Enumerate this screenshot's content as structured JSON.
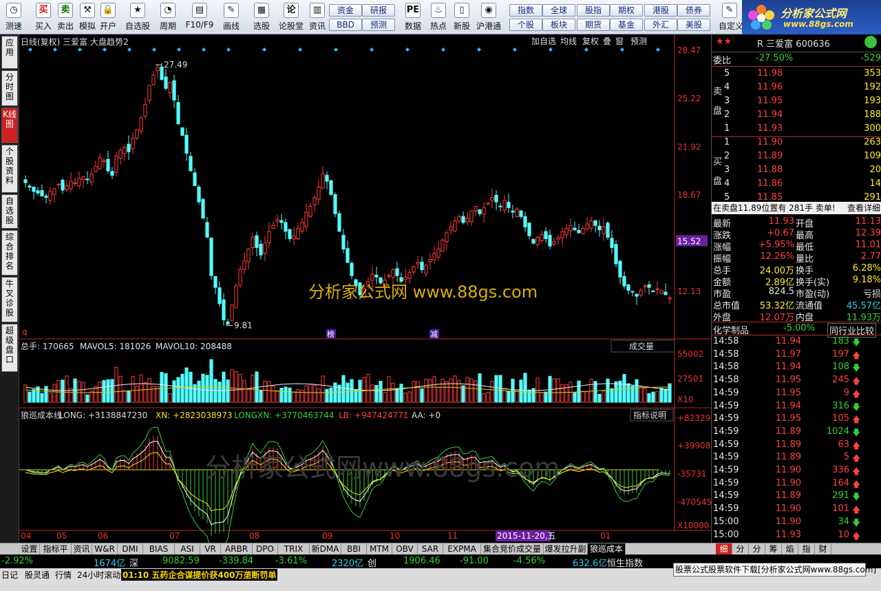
{
  "toolbar": {
    "buttons": [
      {
        "icon": "clock-icon",
        "glyph": "◷",
        "label": "测速"
      },
      {
        "icon": "buy-icon",
        "glyph": "买",
        "label": "买入"
      },
      {
        "icon": "sell-icon",
        "glyph": "卖",
        "label": "卖出"
      },
      {
        "icon": "hammer-icon",
        "glyph": "⚒",
        "label": "模拟"
      },
      {
        "icon": "lock-icon",
        "glyph": "🔒",
        "label": "开户"
      },
      {
        "icon": "star-icon",
        "glyph": "★",
        "label": "自选股"
      },
      {
        "icon": "period-icon",
        "glyph": "◔",
        "label": "周期"
      },
      {
        "icon": "f10-icon",
        "glyph": "▤",
        "label": "F10/F9"
      },
      {
        "icon": "pen-icon",
        "glyph": "✎",
        "label": "画线"
      },
      {
        "icon": "select-icon",
        "glyph": "▦",
        "label": "选股"
      },
      {
        "icon": "forum-icon",
        "glyph": "论",
        "label": "论股堂"
      },
      {
        "icon": "info-icon",
        "glyph": "▥",
        "label": "资讯"
      },
      {
        "icon": "pe-icon",
        "glyph": "PE",
        "label": "数据"
      },
      {
        "icon": "hot-icon",
        "glyph": "♨",
        "label": "热点"
      },
      {
        "icon": "new-icon",
        "glyph": "▯",
        "label": "新股"
      },
      {
        "icon": "hk-connect-icon",
        "glyph": "◉",
        "label": "沪港通"
      },
      {
        "icon": "custom-icon",
        "glyph": "✎",
        "label": "自定义"
      }
    ],
    "quick_buttons": [
      {
        "label": "资金",
        "key": "fund"
      },
      {
        "label": "研报",
        "key": "research"
      },
      {
        "label": "BBD",
        "key": "bbd"
      },
      {
        "label": "预测",
        "key": "forecast"
      },
      {
        "label": "指数",
        "key": "index"
      },
      {
        "label": "全球",
        "key": "global"
      },
      {
        "label": "股指",
        "key": "stockindex"
      },
      {
        "label": "期权",
        "key": "options"
      },
      {
        "label": "港股",
        "key": "hkstock"
      },
      {
        "label": "债券",
        "key": "bond"
      },
      {
        "label": "个股",
        "key": "stock"
      },
      {
        "label": "板块",
        "key": "sector"
      },
      {
        "label": "期货",
        "key": "futures"
      },
      {
        "label": "基金",
        "key": "funds"
      },
      {
        "label": "外汇",
        "key": "forex"
      },
      {
        "label": "美股",
        "key": "usstock"
      }
    ],
    "logo_text": "分析家公式网",
    "logo_url": "www.88gs.com"
  },
  "sidebar": {
    "items": [
      {
        "label": "应用",
        "key": "apps"
      },
      {
        "label": "分时图",
        "key": "intraday"
      },
      {
        "label": "K线图",
        "key": "kline",
        "active": true
      },
      {
        "label": "个股资料",
        "key": "profile"
      },
      {
        "label": "自选股",
        "key": "watchlist"
      },
      {
        "label": "综合排名",
        "key": "ranking"
      },
      {
        "label": "牛叉诊股",
        "key": "diagnose"
      },
      {
        "label": "超级盘口",
        "key": "superbook"
      }
    ]
  },
  "chart_header": {
    "title": "日线(复权)  三爱富 大盘趋势2",
    "buttons": [
      "加自选",
      "均线",
      "复权",
      "叠",
      "窗",
      "预测"
    ]
  },
  "chart_data": [
    {
      "type": "candlestick",
      "title": "日线(复权) 三爱富 大盘趋势2",
      "y_ticks": [
        "28.47",
        "25.22",
        "21.92",
        "18.67",
        "15.52",
        "12.13"
      ],
      "ylim": [
        9.0,
        28.9
      ],
      "current_price_label": "15.52",
      "annotations": {
        "high": "27.49",
        "low": "9.81"
      },
      "markers": [
        "榜",
        "减"
      ],
      "x_ticks": [
        "04",
        "05",
        "06",
        "07",
        "08",
        "09",
        "10",
        "11",
        "2015-11-20,五",
        "01"
      ],
      "close_series": [
        19.5,
        19.2,
        18.9,
        18.8,
        18.6,
        18.5,
        18.9,
        19.1,
        19.4,
        19.0,
        19.3,
        19.6,
        19.5,
        19.8,
        19.9,
        19.7,
        20.1,
        20.6,
        21.2,
        21.0,
        20.3,
        20.0,
        21.3,
        21.7,
        21.9,
        21.6,
        22.5,
        23.1,
        23.9,
        24.8,
        26.1,
        26.8,
        27.3,
        26.5,
        25.9,
        26.3,
        25.1,
        23.5,
        22.7,
        21.5,
        20.3,
        19.3,
        18.2,
        17.1,
        15.8,
        13.2,
        12.4,
        11.3,
        10.2,
        9.9,
        11.2,
        12.5,
        13.6,
        14.2,
        15.0,
        15.8,
        15.1,
        14.6,
        15.4,
        16.2,
        16.6,
        17.0,
        16.8,
        16.2,
        15.7,
        15.9,
        16.4,
        16.8,
        17.5,
        17.9,
        18.5,
        19.2,
        20.1,
        19.6,
        18.7,
        17.4,
        16.2,
        15.0,
        14.1,
        13.2,
        12.5,
        11.9,
        12.3,
        12.8,
        13.3,
        13.1,
        12.7,
        12.9,
        13.2,
        13.6,
        13.2,
        12.8,
        13.1,
        13.4,
        13.8,
        14.1,
        13.6,
        13.9,
        14.3,
        14.7,
        15.0,
        15.6,
        16.1,
        16.5,
        16.9,
        17.2,
        16.8,
        17.1,
        17.6,
        17.9,
        17.4,
        17.8,
        18.1,
        18.5,
        18.2,
        17.9,
        18.3,
        17.8,
        17.5,
        17.7,
        17.2,
        16.5,
        15.9,
        15.4,
        15.8,
        16.0,
        15.7,
        15.2,
        15.5,
        15.8,
        16.2,
        16.4,
        16.6,
        16.3,
        16.1,
        16.4,
        16.7,
        16.9,
        16.6,
        16.3,
        16.5,
        15.8,
        15.1,
        14.0,
        13.1,
        12.5,
        12.2,
        12.1,
        11.8,
        12.2,
        12.5,
        12.4,
        12.1,
        12.3,
        12.2,
        11.9,
        11.7
      ],
      "volume": {
        "label": "总手: 170665",
        "mavol5": "MAVOL5: 181026",
        "mavol10": "MAVOL10: 208488",
        "y_ticks": [
          "55002",
          "27501",
          "X10"
        ],
        "dropdown": "成交量"
      },
      "indicator": {
        "name": "狼巡成本线",
        "long": "LONG: +3138847230",
        "xn": "XN: +2823038973",
        "longxn": "LONGXN: +3770463744",
        "lb": "LB: +947424771",
        "aa": "AA: +0",
        "y_ticks": [
          "+823291",
          "+399082",
          "-35731",
          "-470545",
          "X10000"
        ],
        "button": "指标说明"
      }
    }
  ],
  "watermark": {
    "main": "分析家公式网  www.88gs.com",
    "lower": "分析家公式网www.88gs.com"
  },
  "right_panel": {
    "stars": "★★",
    "code_name": "R 三爱富 600636",
    "weibi_label": "委比",
    "weibi_value": "-27.50%",
    "weibi_extra": "-529",
    "sell_label": "卖盘",
    "buy_label": "买盘",
    "sells": [
      {
        "n": "5",
        "p": "11.98",
        "v": "353"
      },
      {
        "n": "4",
        "p": "11.96",
        "v": "192"
      },
      {
        "n": "3",
        "p": "11.95",
        "v": "193"
      },
      {
        "n": "2",
        "p": "11.94",
        "v": "188"
      },
      {
        "n": "1",
        "p": "11.93",
        "v": "300"
      }
    ],
    "buys": [
      {
        "n": "1",
        "p": "11.90",
        "v": "263"
      },
      {
        "n": "2",
        "p": "11.89",
        "v": "109"
      },
      {
        "n": "3",
        "p": "11.88",
        "v": "20"
      },
      {
        "n": "4",
        "p": "11.86",
        "v": "14"
      },
      {
        "n": "5",
        "p": "11.85",
        "v": "291"
      }
    ],
    "notice": "在卖盘11.89位置有 281手 卖单!",
    "notice_link": "查看详细",
    "stats": [
      [
        "最新",
        "11.93",
        "开盘",
        "11.13"
      ],
      [
        "涨跌",
        "+0.67",
        "最高",
        "12.39"
      ],
      [
        "涨幅",
        "+5.95%",
        "最低",
        "11.01"
      ],
      [
        "振幅",
        "12.26%",
        "量比",
        "2.77"
      ],
      [
        "总手",
        "24.00万",
        "换手",
        "6.28%"
      ],
      [
        "金额",
        "2.89亿",
        "换手(实)",
        "9.18%"
      ],
      [
        "市盈",
        "824.5",
        "市盈(动)",
        "亏损"
      ],
      [
        "总市值",
        "53.32亿",
        "流通值",
        "45.57亿"
      ],
      [
        "外盘",
        "12.07万",
        "内盘",
        "11.93万"
      ]
    ],
    "sector": "化学制品",
    "sector_pct": "-5.00%",
    "sector_btn": "同行业比较",
    "ticks": [
      [
        "14:58",
        "11.94",
        "183",
        "down"
      ],
      [
        "14:58",
        "11.97",
        "197",
        "up"
      ],
      [
        "14:58",
        "11.94",
        "108",
        "down"
      ],
      [
        "14:58",
        "11.95",
        "245",
        "up"
      ],
      [
        "14:59",
        "11.95",
        "9",
        "up"
      ],
      [
        "14:59",
        "11.94",
        "316",
        "down"
      ],
      [
        "14:59",
        "11.95",
        "105",
        "up"
      ],
      [
        "14:59",
        "11.89",
        "1024",
        "down"
      ],
      [
        "14:59",
        "11.89",
        "63",
        "up"
      ],
      [
        "14:59",
        "11.89",
        "5",
        "up"
      ],
      [
        "14:59",
        "11.90",
        "336",
        "up"
      ],
      [
        "14:59",
        "11.90",
        "164",
        "up"
      ],
      [
        "14:59",
        "11.89",
        "291",
        "down"
      ],
      [
        "14:59",
        "11.90",
        "101",
        "up"
      ],
      [
        "15:00",
        "11.90",
        "34",
        "down"
      ],
      [
        "15:00",
        "11.93",
        "10",
        "up"
      ]
    ],
    "bottom_tabs": [
      "细",
      "分",
      "分",
      "筹",
      "焰",
      "指",
      "财"
    ]
  },
  "indicator_tabs": [
    "设置",
    "指标平台",
    "资讯",
    "W&R",
    "DMI",
    "BIAS",
    "ASI",
    "VR",
    "ARBR",
    "DPO",
    "TRIX",
    "新DMA",
    "BBI",
    "MTM",
    "OBV",
    "SAR",
    "EXPMA",
    "集合竞价成交量YH",
    "爆发拉升副图",
    "狼巡成本线"
  ],
  "index_bar": {
    "pct1": "-2.92%",
    "amt1": "1674亿",
    "name1": "深",
    "val2": "9082.59",
    "chg2": "-339.84",
    "pct2": "-3.61%",
    "amt2": "2320亿",
    "name2": "创",
    "val3": "1906.46",
    "chg3": "-91.00",
    "pct3": "-4.56%",
    "amt3": "632.6亿",
    "name3": "恒生指数"
  },
  "ticker": {
    "items": [
      "日记",
      "股灵通",
      "行情",
      "24小时滚动"
    ],
    "headline": "01:10 五药企合谋提价获400万垄断罚单"
  },
  "ad_text": "股票公式股票软件下载[分析家公式网www.88gs.com]"
}
